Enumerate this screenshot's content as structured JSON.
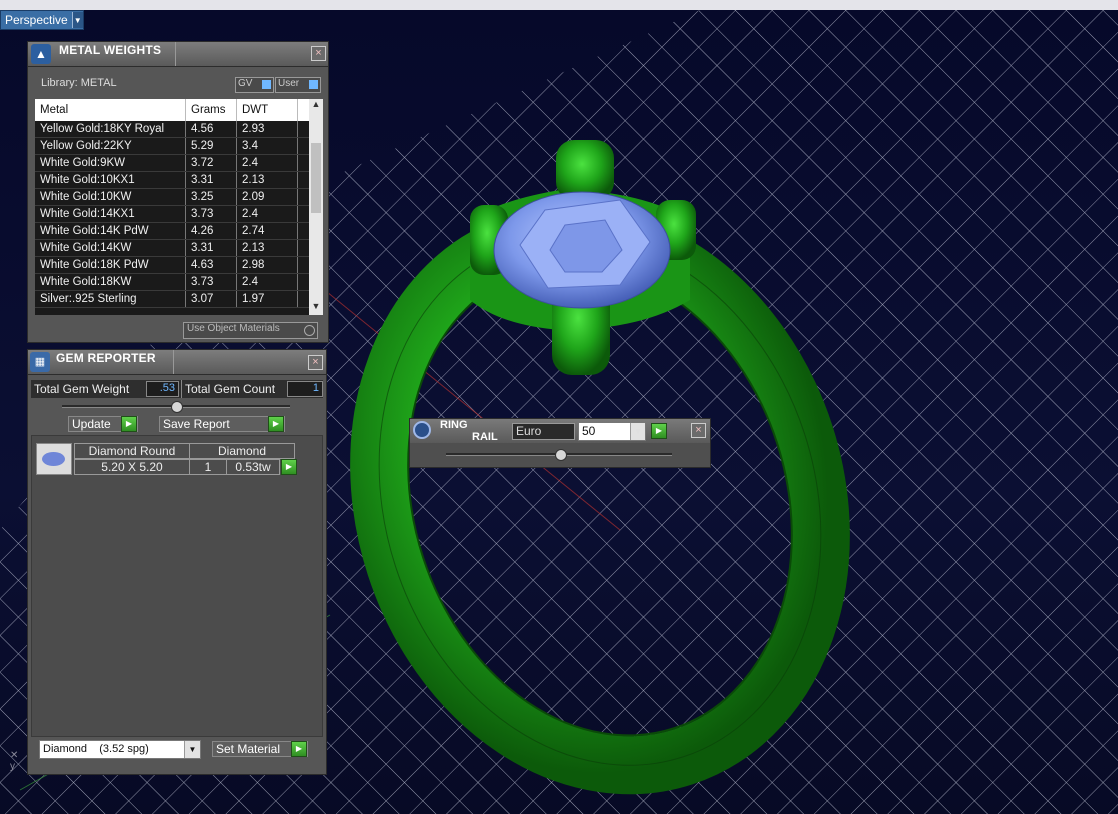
{
  "viewport": {
    "label": "Perspective"
  },
  "metal_weights": {
    "title": "METAL WEIGHTS",
    "library_label": "Library: METAL",
    "gv_toggle": "GV",
    "user_toggle": "User",
    "columns": [
      "Metal",
      "Grams",
      "DWT"
    ],
    "rows": [
      {
        "metal": "Yellow Gold:18KY Royal",
        "grams": "4.56",
        "dwt": "2.93"
      },
      {
        "metal": "Yellow Gold:22KY",
        "grams": "5.29",
        "dwt": "3.4"
      },
      {
        "metal": "White Gold:9KW",
        "grams": "3.72",
        "dwt": "2.4"
      },
      {
        "metal": "White Gold:10KX1",
        "grams": "3.31",
        "dwt": "2.13"
      },
      {
        "metal": "White Gold:10KW",
        "grams": "3.25",
        "dwt": "2.09"
      },
      {
        "metal": "White Gold:14KX1",
        "grams": "3.73",
        "dwt": "2.4"
      },
      {
        "metal": "White Gold:14K PdW",
        "grams": "4.26",
        "dwt": "2.74"
      },
      {
        "metal": "White Gold:14KW",
        "grams": "3.31",
        "dwt": "2.13"
      },
      {
        "metal": "White Gold:18K PdW",
        "grams": "4.63",
        "dwt": "2.98"
      },
      {
        "metal": "White Gold:18KW",
        "grams": "3.73",
        "dwt": "2.4"
      },
      {
        "metal": "Silver:.925 Sterling",
        "grams": "3.07",
        "dwt": "1.97"
      }
    ],
    "use_object_materials": "Use Object Materials"
  },
  "gem_reporter": {
    "title": "GEM REPORTER",
    "total_weight_label": "Total Gem Weight",
    "total_weight_value": ".53",
    "total_count_label": "Total Gem Count",
    "total_count_value": "1",
    "update_label": "Update",
    "save_report_label": "Save Report",
    "gem": {
      "shape": "Diamond Round",
      "material": "Diamond",
      "size": "5.20 X 5.20",
      "count": "1",
      "weight": "0.53tw"
    },
    "material_select": "Diamond    (3.52 spg)",
    "set_material_label": "Set Material"
  },
  "ring_rail": {
    "title_line1": "RING",
    "title_line2": "RAIL",
    "standard": "Euro",
    "size": "50"
  },
  "colors": {
    "ring": "#1fa51a",
    "gem": "#8fa6f0",
    "grid": "#d8d8e8",
    "panel": "#565656"
  }
}
